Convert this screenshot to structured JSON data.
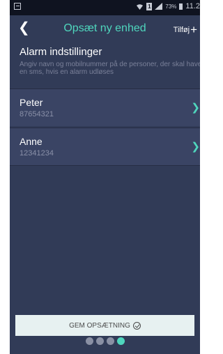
{
  "status_bar": {
    "battery_percent": "73%",
    "time": "11.2"
  },
  "header": {
    "back_glyph": "❮",
    "title": "Opsæt ny enhed",
    "add_label": "Tilføj",
    "add_glyph": "+"
  },
  "intro": {
    "heading": "Alarm indstillinger",
    "description": "Angiv navn og mobilnummer på de personer, der skal have en sms, hvis en alarm udløses"
  },
  "contacts": [
    {
      "name": "Peter",
      "phone": "87654321"
    },
    {
      "name": "Anne",
      "phone": "12341234"
    }
  ],
  "save_button": {
    "label": "GEM OPSÆTNING"
  },
  "pager": {
    "total": 4,
    "active_index": 3
  },
  "colors": {
    "accent": "#4fd6bd",
    "background": "#313b57",
    "row": "#3a4464",
    "button": "#e7f1f1"
  },
  "icons": {
    "back": "chevron-left-icon",
    "add": "plus-icon",
    "row_arrow": "chevron-right-icon",
    "save": "check-circle-icon"
  }
}
